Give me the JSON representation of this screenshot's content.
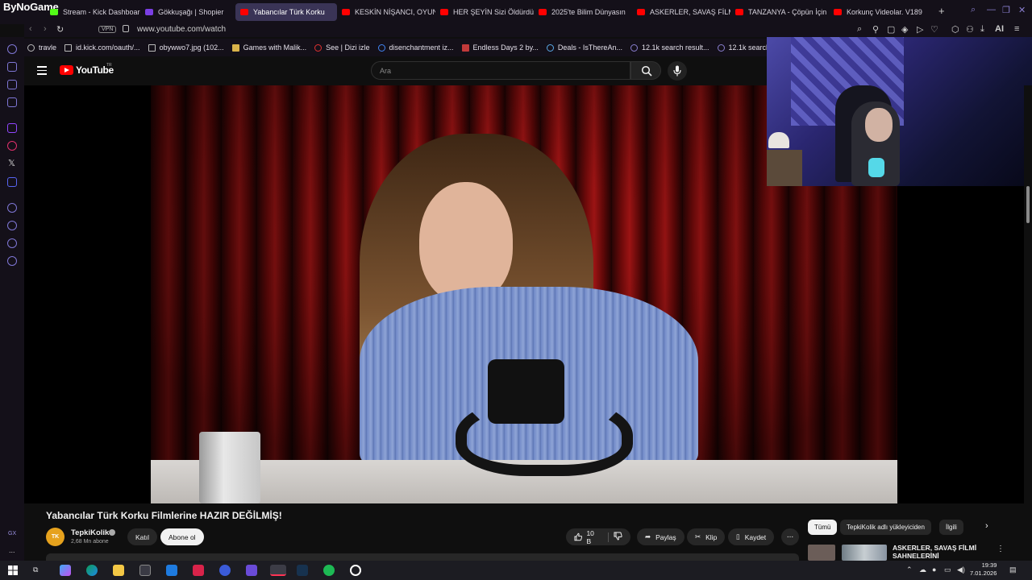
{
  "browser": {
    "brand_tag": "ByNoGame",
    "tabs": [
      {
        "label": "Stream - Kick Dashboard",
        "icon": "kick-icon",
        "color": "#53fc18"
      },
      {
        "label": "Gökkuşağı | Shopier",
        "icon": "shopier-icon",
        "color": "#7b3fe4"
      },
      {
        "label": "Yabancılar Türk Korku",
        "icon": "youtube-icon",
        "color": "#ff0000",
        "active": true
      },
      {
        "label": "KESKİN NİŞANCI, OYUN",
        "icon": "youtube-icon",
        "color": "#ff0000"
      },
      {
        "label": "HER ŞEYİN Sizi Öldürdüğ",
        "icon": "youtube-icon",
        "color": "#ff0000"
      },
      {
        "label": "2025'te Bilim Dünyasın",
        "icon": "youtube-icon",
        "color": "#ff0000"
      },
      {
        "label": "ASKERLER, SAVAŞ FİLMİ",
        "icon": "youtube-icon",
        "color": "#ff0000"
      },
      {
        "label": "TANZANYA - Çöpün İçin",
        "icon": "youtube-icon",
        "color": "#ff0000"
      },
      {
        "label": "Korkunç Videolar. V189",
        "icon": "youtube-icon",
        "color": "#ff0000"
      }
    ],
    "new_tab": "+",
    "vpn_label": "VPN",
    "url": "www.youtube.com/watch",
    "ai_label": "AI",
    "bookmarks": [
      {
        "label": "travle",
        "icon": "globe-icon"
      },
      {
        "label": "id.kick.com/oauth/...",
        "icon": "page-icon"
      },
      {
        "label": "obywwo7.jpg (102...",
        "icon": "page-icon"
      },
      {
        "label": "Games with Malik...",
        "icon": "folder-icon"
      },
      {
        "label": "See | Dizi izle",
        "icon": "play-icon"
      },
      {
        "label": "disenchantment iz...",
        "icon": "google-icon"
      },
      {
        "label": "Endless Days 2 by...",
        "icon": "image-icon"
      },
      {
        "label": "Deals - IsThereAn...",
        "icon": "tag-icon"
      },
      {
        "label": "12.1k search result...",
        "icon": "extension-icon"
      },
      {
        "label": "12.1k search res",
        "icon": "extension-icon"
      }
    ]
  },
  "sidebar": {
    "gx_label": "GX",
    "more": "..."
  },
  "youtube": {
    "logo_text": "YouTube",
    "region": "TR",
    "search_placeholder": "Ara",
    "video_title": "Yabancılar Türk Korku Filmlerine HAZIR DEĞİLMİŞ!",
    "channel": {
      "avatar_text": "TK",
      "name": "TepkiKolik",
      "subscribers": "2,68 Mn abone"
    },
    "join_label": "Katıl",
    "subscribe_label": "Abone ol",
    "likes": "10 B",
    "share_label": "Paylaş",
    "clip_label": "Klip",
    "save_label": "Kaydet",
    "more_label": "...",
    "chips": [
      "Tümü",
      "TepkiKolik adlı yükleyiciden",
      "İlgili"
    ],
    "recommended": {
      "title": "ASKERLER, SAVAŞ FİLMİ SAHNELERİNİ YORUMLUYOR!"
    }
  },
  "taskbar": {
    "time": "19:39",
    "date": "7.01.2026"
  },
  "colors": {
    "accent": "#ff0000",
    "browser_bg": "#141019",
    "youtube_bg": "#0f0f0f",
    "opera_gx": "#7f77d6"
  }
}
